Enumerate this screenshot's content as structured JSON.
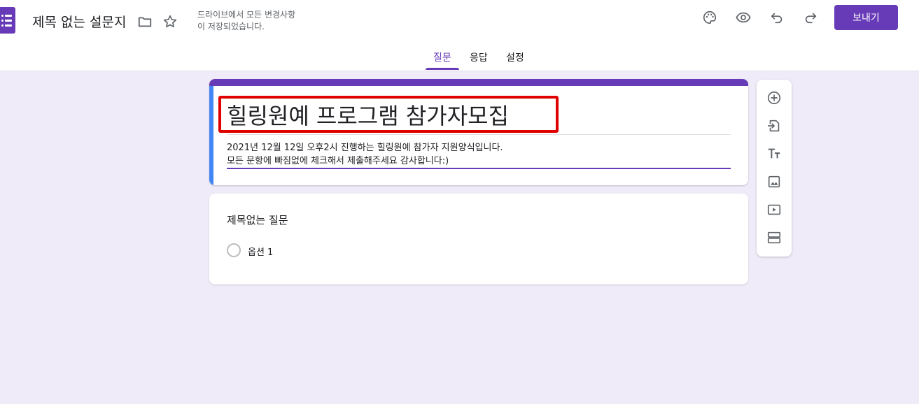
{
  "header": {
    "doc_title": "제목 없는 설문지",
    "save_status_line1": "드라이브에서 모든 변경사항",
    "save_status_line2": "이 저장되었습니다.",
    "send_label": "보내기"
  },
  "tabs": [
    {
      "label": "질문",
      "active": true
    },
    {
      "label": "응답",
      "active": false
    },
    {
      "label": "설정",
      "active": false
    }
  ],
  "form": {
    "title": "힐링원예 프로그램 참가자모집",
    "description_line1": "2021년 12월 12일 오후2시 진행하는 힐링원예 참가자 지원양식입니다.",
    "description_line2": "모든 문항에 빠짐없에 체크해서 제출해주세요 감사합니다:)"
  },
  "question": {
    "title": "제목없는 질문",
    "options": [
      {
        "label": "옵션 1"
      }
    ]
  },
  "colors": {
    "accent": "#673ab7",
    "background": "#f0ebf8",
    "left_bar": "#4285f4",
    "highlight": "#e00000"
  },
  "icons": {
    "header": [
      "folder-icon",
      "star-icon",
      "palette-icon",
      "eye-icon",
      "undo-icon",
      "redo-icon"
    ],
    "side_toolbar": [
      "add-question-icon",
      "import-questions-icon",
      "add-title-icon",
      "add-image-icon",
      "add-video-icon",
      "add-section-icon"
    ]
  }
}
